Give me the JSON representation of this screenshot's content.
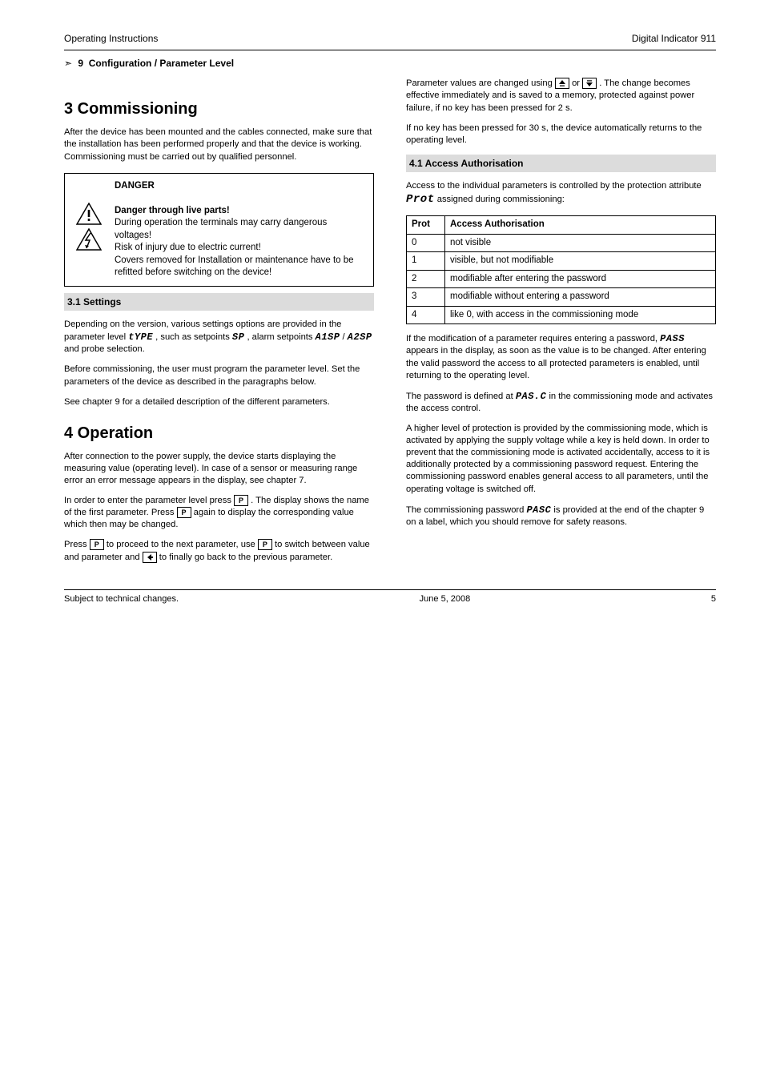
{
  "header": {
    "left": "Operating Instructions",
    "right": "Digital Indicator 911"
  },
  "crossref": {
    "section": "9",
    "title": "Configuration / Parameter Level"
  },
  "cols": {
    "left": {
      "h1": "3 Commissioning",
      "p1": "After the device has been mounted and the cables connected, make sure that the installation has been performed properly and that the device is working. Commissioning must be carried out by qualified personnel.",
      "warn": {
        "title": "DANGER",
        "l1": "Danger through live parts!",
        "l2": "During operation the terminals may carry dangerous voltages!",
        "l3": "Risk of injury due to electric current!",
        "l4": "Covers removed for Installation or maintenance have to be refitted before switching on the device!"
      },
      "h2": "3.1 Settings",
      "p2a": "Depending on the version, various settings options are provided in the parameter level ",
      "p2b": " , such as setpoints ",
      "p2c": " , alarm setpoints ",
      "p2d": " and probe selection.",
      "seg_type": "tYPE",
      "seg_sp": "SP",
      "seg_a1sp": "A1SP",
      "seg_a2sp": "A2SP",
      "p3": "Before commissioning, the user must program the parameter level. Set the parameters of the device as described in the paragraphs below.",
      "p4": "See chapter 9 for a detailed description of the different parameters.",
      "h1b": "4 Operation",
      "p5": "After connection to the power supply, the device starts displaying the measuring value (operating level). In case of a sensor or measuring range error an error message appears in the display, see chapter 7.",
      "p6a": "In order to enter the parameter level press ",
      "p6b": " . The display shows the name of the first parameter. Press",
      "p6c": "again to display the corresponding value which then may be changed.",
      "p7a": "Press ",
      "p7b": " to proceed to the next parameter, use ",
      "p7c": " to switch between value and parameter and ",
      "p7d": " to finally go back to the previous parameter."
    },
    "right": {
      "p1a": "Parameter values are changed using ",
      "p1b": " or ",
      "p1c": ". The change becomes effective immediately and is saved to a memory, protected against power failure, if no key has been pressed for 2 s.",
      "p2": "If no key has been pressed for 30 s, the device automatically returns to the operating level.",
      "h2": "4.1 Access Authorisation",
      "p3a": "Access to the individual parameters is controlled by the protection attribute ",
      "p3b": " assigned during commissioning:",
      "seg_prot": "Prot",
      "tbl": {
        "h1": "Prot",
        "h2": "Access Authorisation",
        "r1a": "0",
        "r1b": "not visible",
        "r2a": "1",
        "r2b": "visible, but not modifiable",
        "r3a": "2",
        "r3b": "modifiable after entering the password",
        "r4a": "3",
        "r4b": "modifiable without entering a password",
        "r5a": "4",
        "r5b": "like 0, with access in the commissioning mode"
      },
      "p4a": "If the modification of a parameter requires entering a password, ",
      "p4b": " appears in the display, as soon as the value is to be changed. After entering the valid password the access to all protected parameters is enabled, until returning to the operating level.",
      "seg_pass": "PASS",
      "p5a": "The password is defined at ",
      "p5b": " in the commissioning mode and activates the access control.",
      "seg_pasc1": "PAS.C",
      "p6a": "A higher level of protection is provided by the commissioning mode, which is activated by applying the supply voltage while a key is held down. In order to prevent that the commissioning mode is activated accidentally, access to it is additionally protected by a commissioning password request. Entering the commissioning password enables general access to all parameters, until the operating voltage is switched off.",
      "p7a": "The commissioning password ",
      "p7b": " is provided at the end of the chapter 9 on a label, which you should remove for safety reasons.",
      "seg_pasc2": "PASC"
    }
  },
  "footer": {
    "left": "Subject to technical changes.",
    "mid": "June 5, 2008",
    "right": "5"
  }
}
